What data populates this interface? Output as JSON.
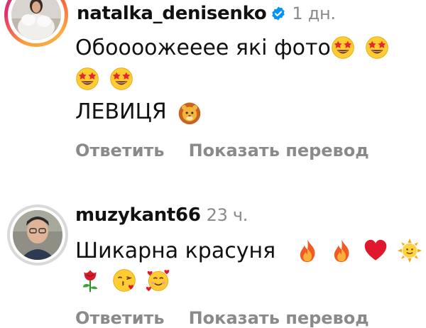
{
  "comments": [
    {
      "username": "natalka_denisenko",
      "verified": true,
      "time": "1 дн.",
      "line1": "Обоооожееее які фото",
      "line2": "ЛЕВИЦЯ",
      "reply_label": "Ответить",
      "translate_label": "Показать перевод",
      "emojis": [
        "star-struck",
        "star-struck",
        "star-struck",
        "star-struck",
        "lion-face"
      ]
    },
    {
      "username": "muzykant66",
      "verified": false,
      "time": "23 ч.",
      "line1": "Шикарна красуня",
      "reply_label": "Ответить",
      "translate_label": "Показать перевод",
      "emojis": [
        "fire",
        "fire",
        "red-heart",
        "sun-with-face",
        "rose",
        "face-blowing-kiss",
        "smiling-face-with-hearts"
      ]
    }
  ]
}
